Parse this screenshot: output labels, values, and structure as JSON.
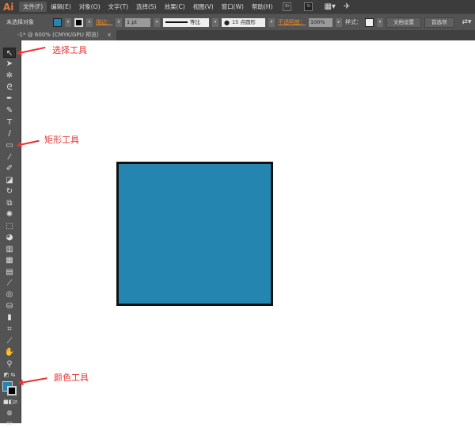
{
  "app": {
    "logo": "Ai"
  },
  "menu": [
    "文件(F)",
    "编辑(E)",
    "对象(O)",
    "文字(T)",
    "选择(S)",
    "效果(C)",
    "视图(V)",
    "窗口(W)",
    "帮助(H)"
  ],
  "menubar_icons": [
    "Br",
    "St"
  ],
  "control": {
    "selection": "未选择对象",
    "fill_color": "#2486b0",
    "stroke_label": "描边：",
    "stroke_weight": "1 pt",
    "stroke_profile": "等比",
    "brush": "15 点圆形",
    "opacity_label": "不透明度：",
    "opacity": "100%",
    "style_label": "样式：",
    "doc_setup": "文档设置",
    "preferences": "首选项"
  },
  "tab": {
    "title": "-1* @ 600% (CMYK/GPU 预览)",
    "close": "×"
  },
  "canvas": {
    "rect_fill": "#2486b0",
    "rect_stroke": "#111111"
  },
  "annotations": {
    "select": "选择工具",
    "rect": "矩形工具",
    "color": "颜色工具"
  }
}
